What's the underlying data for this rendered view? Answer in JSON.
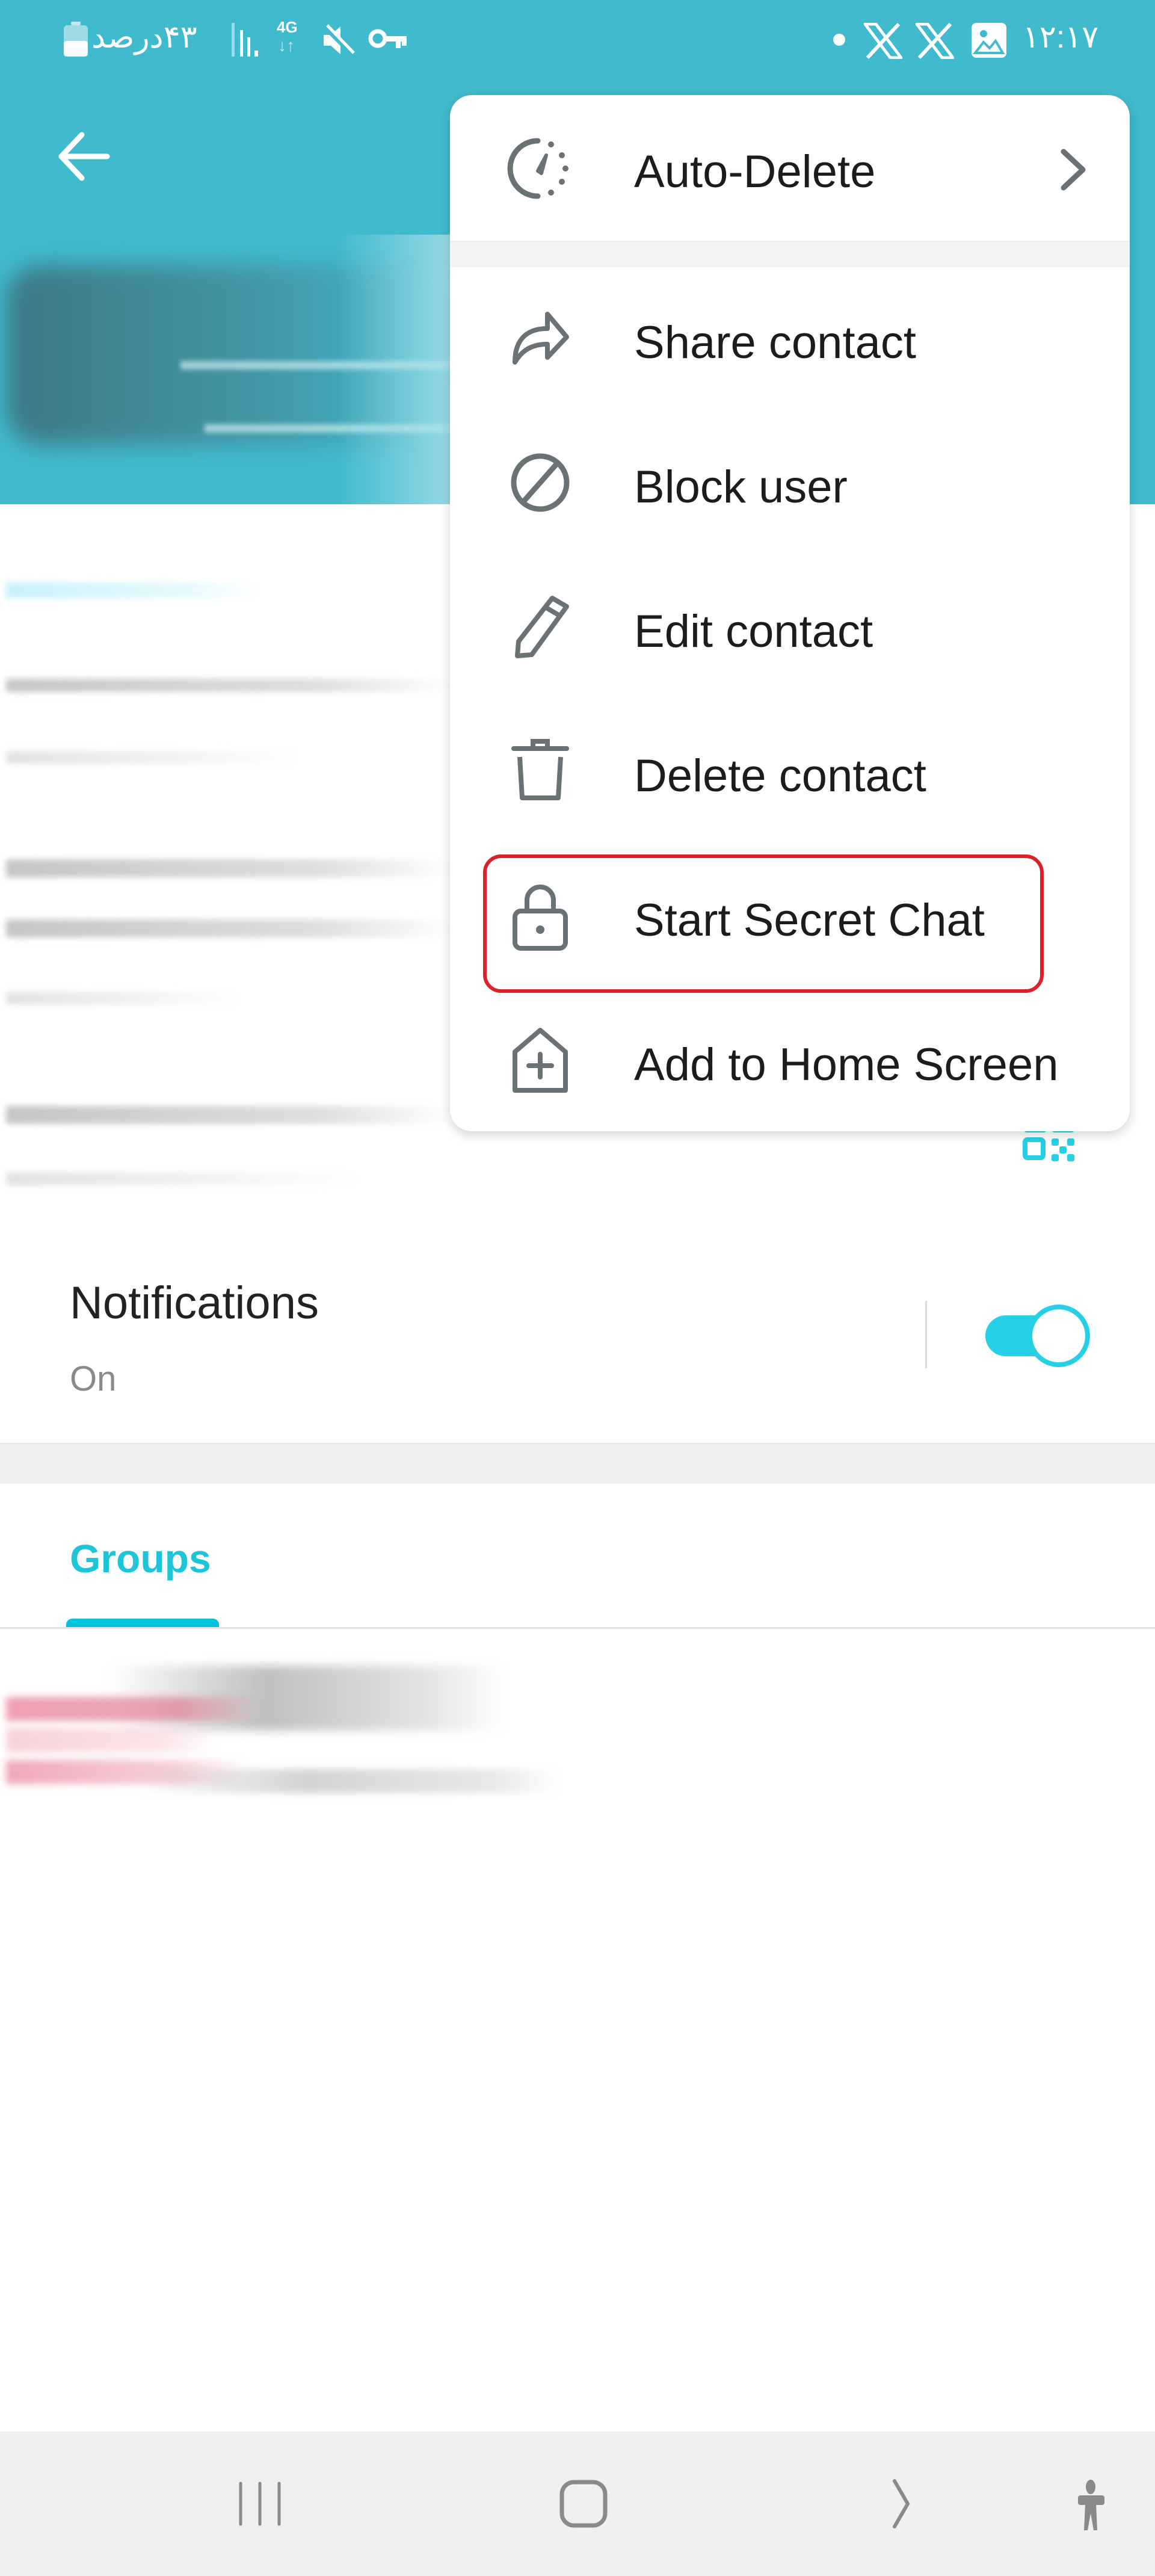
{
  "status_bar": {
    "battery_text": "۴۳درصد",
    "network_type": "4G",
    "time": "۱۲:۱۷",
    "left_icons": [
      "battery-icon",
      "signal-icon",
      "network-4g-icon",
      "mute-icon",
      "vpn-key-icon"
    ],
    "right_icons": [
      "notification-dot-icon",
      "x-app-icon",
      "x-app-icon",
      "gallery-icon"
    ]
  },
  "header": {
    "back_icon": "arrow-left-icon",
    "contact_name": "",
    "accent_color": "#40bacd"
  },
  "menu": {
    "auto_delete": {
      "label": "Auto-Delete",
      "icon": "timer-icon",
      "has_submenu": true
    },
    "items": [
      {
        "label": "Share contact",
        "icon": "share-icon"
      },
      {
        "label": "Block user",
        "icon": "block-icon"
      },
      {
        "label": "Edit contact",
        "icon": "pencil-icon"
      },
      {
        "label": "Delete contact",
        "icon": "trash-icon"
      },
      {
        "label": "Start Secret Chat",
        "icon": "lock-icon",
        "highlighted": true
      },
      {
        "label": "Add to Home Screen",
        "icon": "add-home-icon"
      }
    ],
    "highlight_color": "#d8232a"
  },
  "notifications": {
    "title": "Notifications",
    "status": "On",
    "toggle_on": true,
    "toggle_color": "#25d0e6"
  },
  "tabs": [
    {
      "label": "Groups",
      "active": true
    }
  ],
  "nav_bar": {
    "buttons": [
      "recents-icon",
      "home-icon",
      "back-icon",
      "accessibility-icon"
    ]
  }
}
